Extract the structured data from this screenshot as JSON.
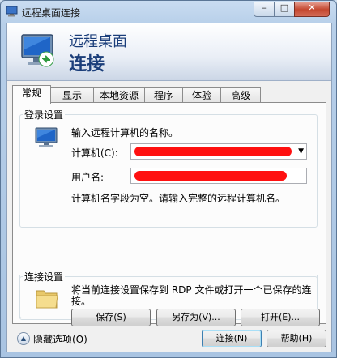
{
  "window": {
    "title": "远程桌面连接"
  },
  "titlebar": {
    "min": "–",
    "max": "□",
    "close": "✕"
  },
  "header": {
    "line1": "远程桌面",
    "line2": "连接"
  },
  "tabs": [
    "常规",
    "显示",
    "本地资源",
    "程序",
    "体验",
    "高级"
  ],
  "login": {
    "legend": "登录设置",
    "instruction": "输入远程计算机的名称。",
    "computer_label": "计算机(C):",
    "username_label": "用户名:",
    "note": "计算机名字段为空。请输入完整的远程计算机名。"
  },
  "connection": {
    "legend": "连接设置",
    "description_line1": "将当前连接设置保存到 RDP 文件或打开一个已保存的连",
    "description_line2": "接。",
    "save_label": "保存(S)",
    "saveas_label": "另存为(V)...",
    "open_label": "打开(E)..."
  },
  "footer": {
    "hide_options": "隐藏选项(O)",
    "connect_label": "连接(N)",
    "help_label": "帮助(H)"
  },
  "colors": {
    "redaction": "#ff1010",
    "header_text": "#1b3e7a"
  }
}
